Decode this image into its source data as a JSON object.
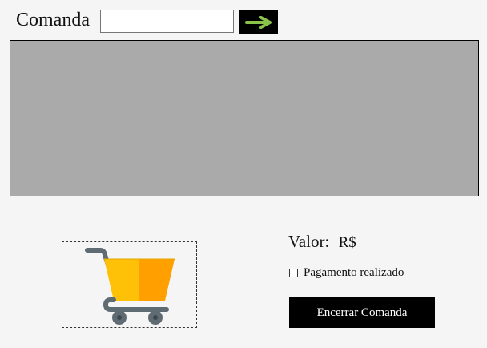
{
  "header": {
    "comanda_label": "Comanda",
    "comanda_input": {
      "value": "",
      "placeholder": ""
    },
    "submit_icon": "right-arrow-icon"
  },
  "items_panel": {
    "items": []
  },
  "cart": {
    "icon": "shopping-cart-icon"
  },
  "summary": {
    "valor_label": "Valor:",
    "currency": "R$",
    "amount": ""
  },
  "payment": {
    "label": "Pagamento realizado",
    "checked": false
  },
  "actions": {
    "close_label": "Encerrar Comanda"
  },
  "colors": {
    "page_background": "#f5f5f5",
    "panel_background": "#aaaaaa",
    "button_background": "#000000",
    "arrow": "#8bc34a",
    "cart_yellow": "#ffc107",
    "cart_orange": "#ff9f00",
    "cart_gray": "#5f6b73"
  }
}
